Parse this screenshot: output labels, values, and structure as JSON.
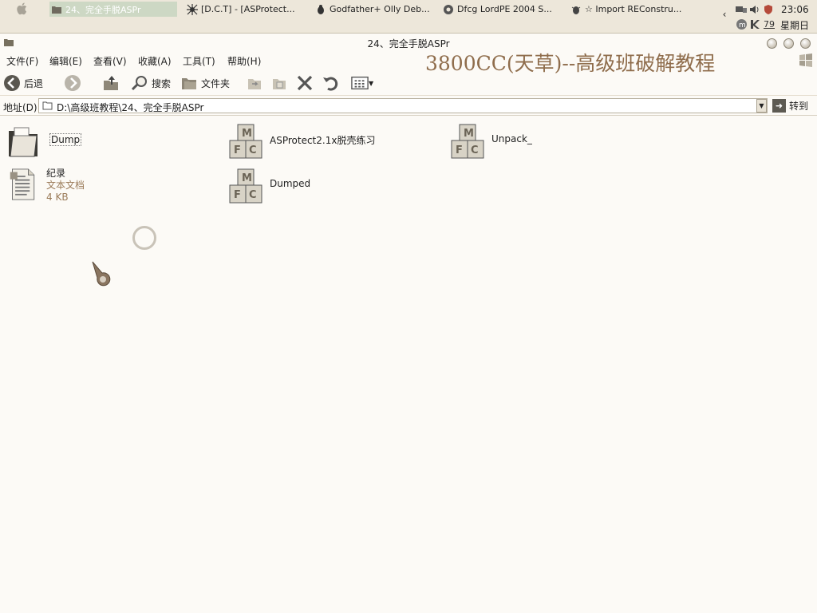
{
  "taskbar": {
    "tasks": [
      {
        "label": "24、完全手脱ASPr",
        "active": true,
        "icon": "folder-icon"
      },
      {
        "label": "[D.C.T] - [ASProtect...",
        "active": false,
        "icon": "spider-icon"
      },
      {
        "label": "Godfather+ Olly Deb...",
        "active": false,
        "icon": "bug-icon"
      },
      {
        "label": "Dfcg LordPE 2004 S...",
        "active": false,
        "icon": "gear-icon"
      },
      {
        "label": "☆ Import REConstru...",
        "active": false,
        "icon": "bug-icon"
      }
    ],
    "tray_number": "79",
    "clock": "23:06",
    "weekday": "星期日"
  },
  "window": {
    "title": "24、完全手脱ASPr"
  },
  "menu": {
    "items": [
      "文件(F)",
      "编辑(E)",
      "查看(V)",
      "收藏(A)",
      "工具(T)",
      "帮助(H)"
    ]
  },
  "watermark": "3800CC(天草)--高级班破解教程",
  "toolbar": {
    "back_label": "后退",
    "search_label": "搜索",
    "folders_label": "文件夹"
  },
  "address": {
    "label": "地址(D)",
    "value": "D:\\高级班教程\\24、完全手脱ASPr",
    "go_label": "转到"
  },
  "files": [
    {
      "name": "Dump",
      "type": "folder",
      "selected": true
    },
    {
      "name": "ASProtect2.1x脱壳练习",
      "type": "mfc-app"
    },
    {
      "name": "Unpack_",
      "type": "mfc-app"
    },
    {
      "name": "纪录",
      "type": "text-document",
      "kind": "文本文档",
      "size": "4 KB"
    },
    {
      "name": "Dumped",
      "type": "mfc-app"
    }
  ],
  "colors": {
    "taskbar_bg": "#ede7da",
    "window_bg": "#fcfaf6",
    "watermark": "#8f6d4c",
    "active_task": "#cdd8c4"
  }
}
